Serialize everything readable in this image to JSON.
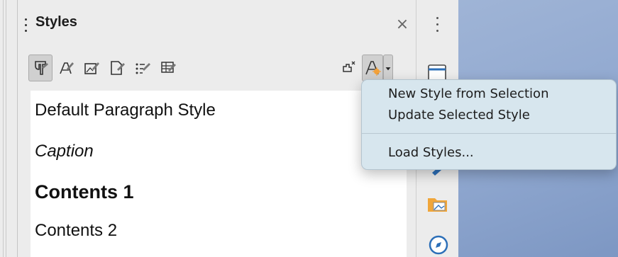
{
  "panel": {
    "title": "Styles",
    "close_glyph": "×"
  },
  "toolbar": {
    "icons": [
      "paragraph-styles-icon",
      "character-styles-icon",
      "frame-styles-icon",
      "page-styles-icon",
      "list-styles-icon",
      "table-styles-icon",
      "fill-format-mode-icon",
      "styles-actions-icon",
      "dropdown-arrow-icon"
    ]
  },
  "styles_list": {
    "items": [
      "Default Paragraph Style",
      "Caption",
      "Contents 1",
      "Contents 2"
    ]
  },
  "context_menu": {
    "items": [
      "New Style from Selection",
      "Update Selected Style",
      "Load Styles..."
    ]
  },
  "colors": {
    "menu_bg": "#d7e6ee",
    "panel_bg": "#ececec",
    "desktop_bg": "#8fa7cf"
  }
}
